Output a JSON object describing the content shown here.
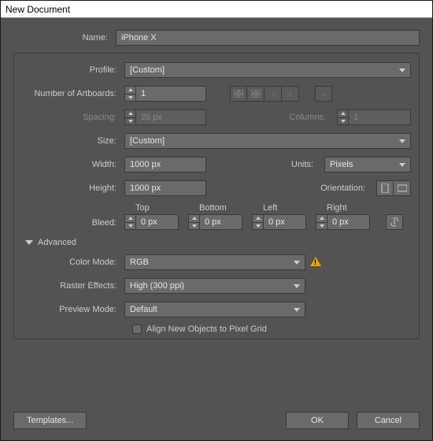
{
  "window": {
    "title": "New Document"
  },
  "fields": {
    "name": {
      "label": "Name:",
      "value": "iPhone X"
    },
    "profile": {
      "label": "Profile:",
      "value": "[Custom]"
    },
    "artboards": {
      "label": "Number of Artboards:",
      "value": "1"
    },
    "spacing": {
      "label": "Spacing:",
      "value": "20 px"
    },
    "columns": {
      "label": "Columns:",
      "value": "1"
    },
    "size": {
      "label": "Size:",
      "value": "[Custom]"
    },
    "width": {
      "label": "Width:",
      "value": "1000 px"
    },
    "height": {
      "label": "Height:",
      "value": "1000 px"
    },
    "units": {
      "label": "Units:",
      "value": "Pixels"
    },
    "orientation": {
      "label": "Orientation:"
    },
    "bleed": {
      "label": "Bleed:",
      "top": {
        "label": "Top",
        "value": "0 px"
      },
      "bottom": {
        "label": "Bottom",
        "value": "0 px"
      },
      "left": {
        "label": "Left",
        "value": "0 px"
      },
      "right": {
        "label": "Right",
        "value": "0 px"
      }
    }
  },
  "advanced": {
    "label": "Advanced",
    "color_mode": {
      "label": "Color Mode:",
      "value": "RGB"
    },
    "raster": {
      "label": "Raster Effects:",
      "value": "High (300 ppi)"
    },
    "preview": {
      "label": "Preview Mode:",
      "value": "Default"
    },
    "align_grid": {
      "label": "Align New Objects to Pixel Grid",
      "checked": false
    }
  },
  "buttons": {
    "templates": "Templates...",
    "ok": "OK",
    "cancel": "Cancel"
  }
}
